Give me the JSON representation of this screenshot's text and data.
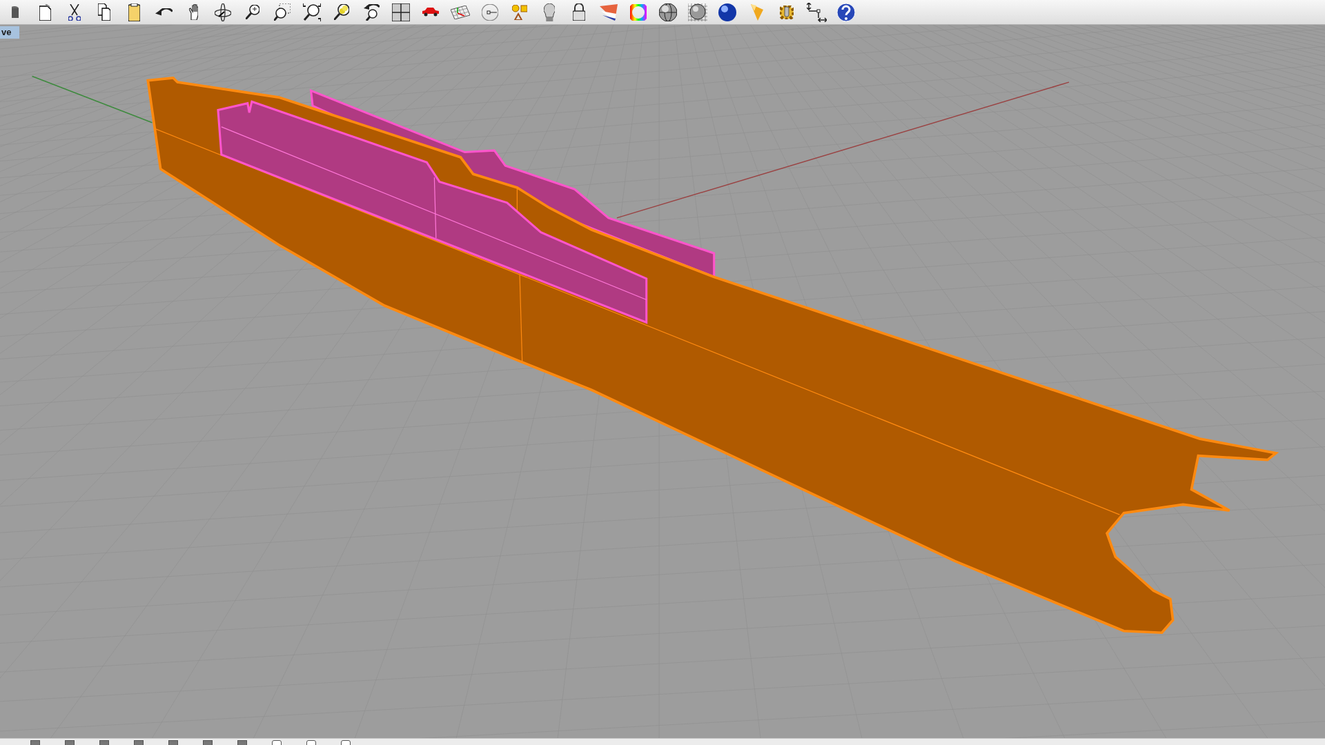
{
  "viewport": {
    "title": "ve"
  },
  "status_bar": {
    "osnaps": [
      {
        "checked": true
      },
      {
        "checked": true
      },
      {
        "checked": true
      },
      {
        "checked": true
      },
      {
        "checked": true
      },
      {
        "checked": true
      },
      {
        "checked": true
      },
      {
        "checked": false
      },
      {
        "checked": false
      },
      {
        "checked": false
      }
    ]
  }
}
